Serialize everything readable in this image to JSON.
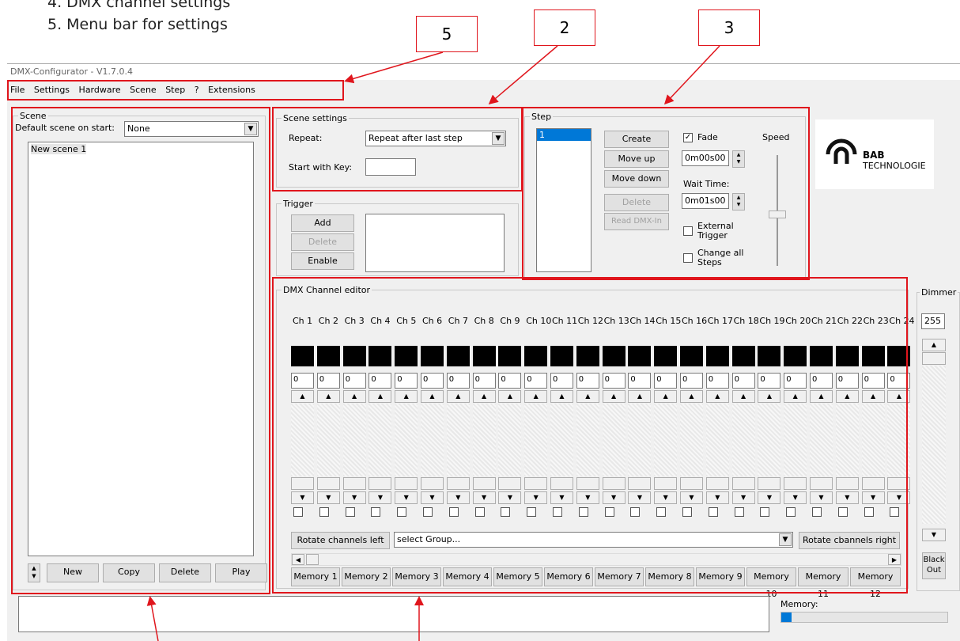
{
  "doc": {
    "line4": "4.   DMX channel settings",
    "line5": "5.   Menu bar for settings"
  },
  "callouts": {
    "c5": "5",
    "c2": "2",
    "c3": "3"
  },
  "window": {
    "title": "DMX-Configurator - V1.7.0.4"
  },
  "menu": [
    "File",
    "Settings",
    "Hardware",
    "Scene",
    "Step",
    "?",
    "Extensions"
  ],
  "scene": {
    "title": "Scene",
    "default_label": "Default scene on start:",
    "default_value": "None",
    "items": [
      "New scene 1"
    ],
    "buttons": {
      "new": "New",
      "copy": "Copy",
      "delete": "Delete",
      "play": "Play"
    }
  },
  "scene_settings": {
    "title": "Scene settings",
    "repeat_label": "Repeat:",
    "repeat_value": "Repeat after last step",
    "start_label": "Start with Key:",
    "start_value": ""
  },
  "trigger": {
    "title": "Trigger",
    "add": "Add",
    "delete": "Delete",
    "enable": "Enable"
  },
  "step": {
    "title": "Step",
    "items": [
      "1"
    ],
    "create": "Create",
    "move_up": "Move up",
    "move_down": "Move down",
    "delete": "Delete",
    "read": "Read DMX-In",
    "fade_label": "Fade",
    "fade_value": "0m00s00",
    "wait_label": "Wait Time:",
    "wait_value": "0m01s00",
    "ext_trigger": "External Trigger",
    "change_all": "Change all Steps",
    "speed_label": "Speed"
  },
  "logo": {
    "brand1": "BAB",
    "brand2": "TECHNOLOGIE"
  },
  "dmx": {
    "title": "DMX Channel editor",
    "channels": [
      "Ch 1",
      "Ch 2",
      "Ch 3",
      "Ch 4",
      "Ch 5",
      "Ch 6",
      "Ch 7",
      "Ch 8",
      "Ch 9",
      "Ch 10",
      "Ch 11",
      "Ch 12",
      "Ch 13",
      "Ch 14",
      "Ch 15",
      "Ch 16",
      "Ch 17",
      "Ch 18",
      "Ch 19",
      "Ch 20",
      "Ch 21",
      "Ch 22",
      "Ch 23",
      "Ch 24"
    ],
    "values": [
      "0",
      "0",
      "0",
      "0",
      "0",
      "0",
      "0",
      "0",
      "0",
      "0",
      "0",
      "0",
      "0",
      "0",
      "0",
      "0",
      "0",
      "0",
      "0",
      "0",
      "0",
      "0",
      "0",
      "0"
    ],
    "rotate_left": "Rotate channels left",
    "group_placeholder": "select Group...",
    "rotate_right": "Rotate cbannels right",
    "memories": [
      "Memory 1",
      "Memory 2",
      "Memory 3",
      "Memory 4",
      "Memory 5",
      "Memory 6",
      "Memory 7",
      "Memory 8",
      "Memory 9",
      "Memory 10",
      "Memory 11",
      "Memory 12"
    ]
  },
  "dimmer": {
    "title": "Dimmer",
    "value": "255",
    "blackout": "Black Out"
  },
  "status": {
    "memory_label": "Memory:",
    "memory_fill": 0.06
  }
}
